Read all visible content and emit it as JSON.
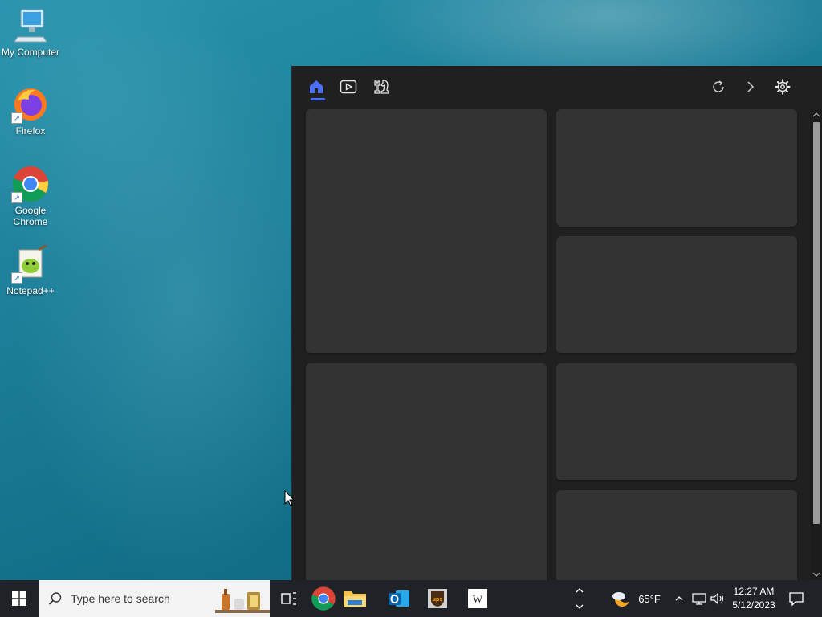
{
  "desktop": {
    "icons": [
      {
        "label": "My Computer",
        "icon": "computer-icon"
      },
      {
        "label": "Firefox",
        "icon": "firefox-icon"
      },
      {
        "label": "Google Chrome",
        "icon": "chrome-icon"
      },
      {
        "label": "Notepad++",
        "icon": "notepadpp-icon"
      }
    ]
  },
  "widgets_panel": {
    "toolbar": {
      "left_icons": [
        "home-icon",
        "play-video-icon",
        "chess-icon"
      ],
      "right_icons": [
        "refresh-icon",
        "chevron-right-icon",
        "settings-gear-icon"
      ],
      "active_tab": "home"
    },
    "cards": 6,
    "accent_color": "#4c6ef5"
  },
  "taskbar": {
    "search_placeholder": "Type here to search",
    "pinned": [
      "task-view-icon",
      "chrome-icon",
      "file-explorer-icon",
      "outlook-icon",
      "ups-icon",
      "wikipedia-icon"
    ],
    "weather": {
      "temp": "65°F",
      "icon": "partly-cloudy-night-icon"
    },
    "clock": {
      "time": "12:27 AM",
      "date": "5/12/2023"
    },
    "tray_icons": [
      "show-hidden-icons-chevron",
      "network-icon",
      "volume-icon",
      "notification-icon"
    ]
  }
}
